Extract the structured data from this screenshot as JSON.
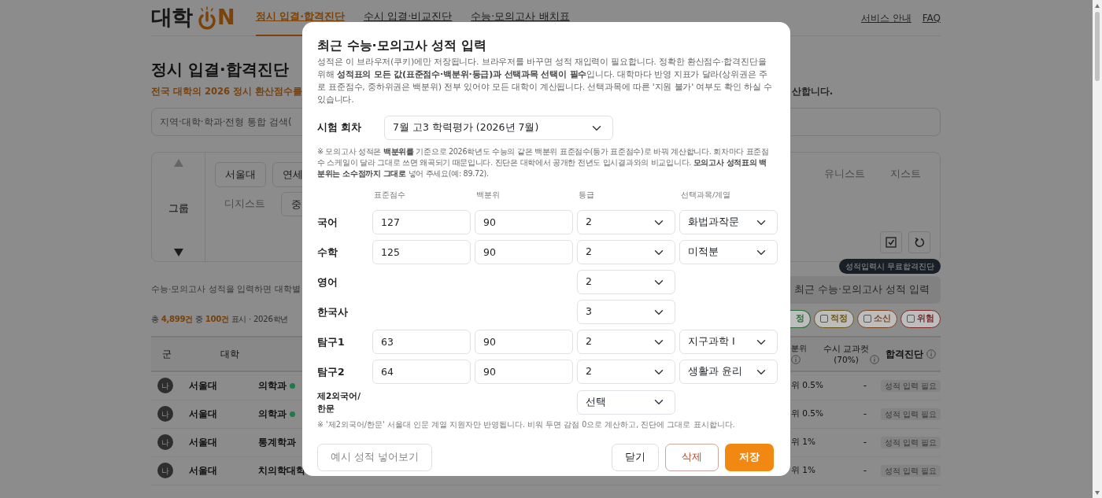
{
  "header": {
    "logo": {
      "text": "대학",
      "accent": "N"
    },
    "nav": [
      {
        "label": "정시 입결·합격진단",
        "selected": true
      },
      {
        "label": "수시 입결·비교진단",
        "selected": false
      },
      {
        "label": "수능·모의고사 배치표",
        "selected": false
      }
    ],
    "links": [
      "서비스 안내",
      "FAQ"
    ]
  },
  "page": {
    "title": "정시 입결·합격진단",
    "subtitle": "전국 대학의 2026 정시 환산점수를",
    "subtitle_end": "산합니다.",
    "search": {
      "placeholder": "지역·대학·학과·전형 통합 검색("
    },
    "filter": {
      "group_label": "그룹",
      "chips_left": [
        {
          "label": "서울대",
          "kind": "chip"
        },
        {
          "label": "연세",
          "kind": "chip"
        }
      ],
      "chips_left2": [
        {
          "label": "디지스트",
          "kind": "text"
        },
        {
          "label": "중",
          "kind": "chip"
        }
      ],
      "chips_right": [
        {
          "label": "유니스트",
          "kind": "text"
        },
        {
          "label": "지스트",
          "kind": "text"
        }
      ]
    },
    "hint": "수능·모의고사 성적을 입력하면 대학별",
    "score_button": {
      "label": "최근 수능·모의고사 성적 입력",
      "tooltip": "성적입력시 무료합격진단"
    },
    "count": [
      {
        "text": "총 ",
        "highlight": false
      },
      {
        "text": "4,899건",
        "highlight": true
      },
      {
        "text": " 중 ",
        "highlight": false
      },
      {
        "text": "100건",
        "highlight": true
      },
      {
        "text": " 표시 · 2026학년",
        "highlight": false
      }
    ],
    "verdicts": [
      {
        "label": "정",
        "color": "#2f6a3c",
        "kind": "cut"
      },
      {
        "label": "적정",
        "color": "#6a5618",
        "checked": false,
        "kind": "chip"
      },
      {
        "label": "소신",
        "color": "#7a4420",
        "checked": false,
        "kind": "chip"
      },
      {
        "label": "위험",
        "color": "#7a2828",
        "checked": false,
        "kind": "chip"
      }
    ],
    "table": {
      "columns_left": [
        "군",
        "대학"
      ],
      "columns_right": [
        "분위",
        "수시 교과컷 (70%)",
        "합격진단"
      ],
      "rows": [
        {
          "group": "나",
          "university": "서울대",
          "department": "의학과",
          "color": "#1e7a48",
          "rank": "위 0.5%",
          "cut": "-",
          "status": "성적 입력 필요"
        },
        {
          "group": "나",
          "university": "서울대",
          "department": "의학과",
          "color": "#1e7a48",
          "rank": "위 0.5%",
          "cut": "-",
          "status": "성적 입력 필요"
        },
        {
          "group": "나",
          "university": "서울대",
          "department": "통계학과",
          "rank": "위 1%",
          "cut": "-",
          "status": "성적 입력 필요"
        },
        {
          "group": "나",
          "university": "서울대",
          "department": "치의학대학",
          "rank": "위 1%",
          "cut": "-",
          "status": "성적 입력 필요"
        }
      ]
    }
  },
  "modal": {
    "title": "최근 수능·모의고사 성적 입력",
    "intro": "성적은 이 브라우저(쿠키)에만 저장됩니다. 브라우저를 바꾸면 성적 재입력이 필요합니다. 정확한 환산점수·합격진단을 위해 **성적표의 모든 값(표준점수·백분위·등급)과 선택과목 선택이 필수**입니다. 대학마다 반영 지표가 달라(상위권은 주로 표준점수, 중하위권은 백분위) 전부 있어야 모든 대학이 계산됩니다. 선택과목에 따른 '지원 불가' 여부도 확인 하실 수 있습니다.",
    "exam": {
      "label": "시험 회차",
      "value": "7월 고3 학력평가 (2026년 7월)"
    },
    "note": "※ 모의고사 성적은 **백분위를** 기준으로 2026학년도 수능의 같은 백분위 표준점수(등가 표준점수)로 바꿔 계산합니다. 회차마다 표준점수 스케일이 달라 그대로 쓰면 왜곡되기 때문입니다. 진단은 대학에서 공개한 전년도 입시결과와의 비교입니다. **모의고사 성적표의 백분위는 소수점까지 그대로** 넣어 주세요(예: 89.72).",
    "columns": [
      "표준점수",
      "백분위",
      "등급",
      "선택과목/계열"
    ],
    "subjects": [
      {
        "name": "국어",
        "standard": "127",
        "percentile": "90",
        "grade": "2",
        "elective": "화법과작문"
      },
      {
        "name": "수학",
        "standard": "125",
        "percentile": "90",
        "grade": "2",
        "elective": "미적분"
      },
      {
        "name": "영어",
        "grade": "2"
      },
      {
        "name": "한국사",
        "grade": "3"
      },
      {
        "name": "탐구1",
        "standard": "63",
        "percentile": "90",
        "grade": "2",
        "elective": "지구과학 I"
      },
      {
        "name": "탐구2",
        "standard": "64",
        "percentile": "90",
        "grade": "2",
        "elective": "생활과 윤리"
      },
      {
        "name": "제2외국어/한문",
        "grade": "선택"
      }
    ],
    "footnote": "※ '제2외국어/한문' 서울대 인문 계열 지원자만 반영됩니다. 비워 두면 감점 0으로 계산하고, 진단에 그대로 표시합니다.",
    "buttons": [
      {
        "label": "예시 성적 넣어보기",
        "kind": "outline"
      },
      {
        "label": "닫기",
        "kind": "plain"
      },
      {
        "label": "삭제",
        "kind": "danger"
      },
      {
        "label": "저장",
        "kind": "primary"
      }
    ]
  }
}
